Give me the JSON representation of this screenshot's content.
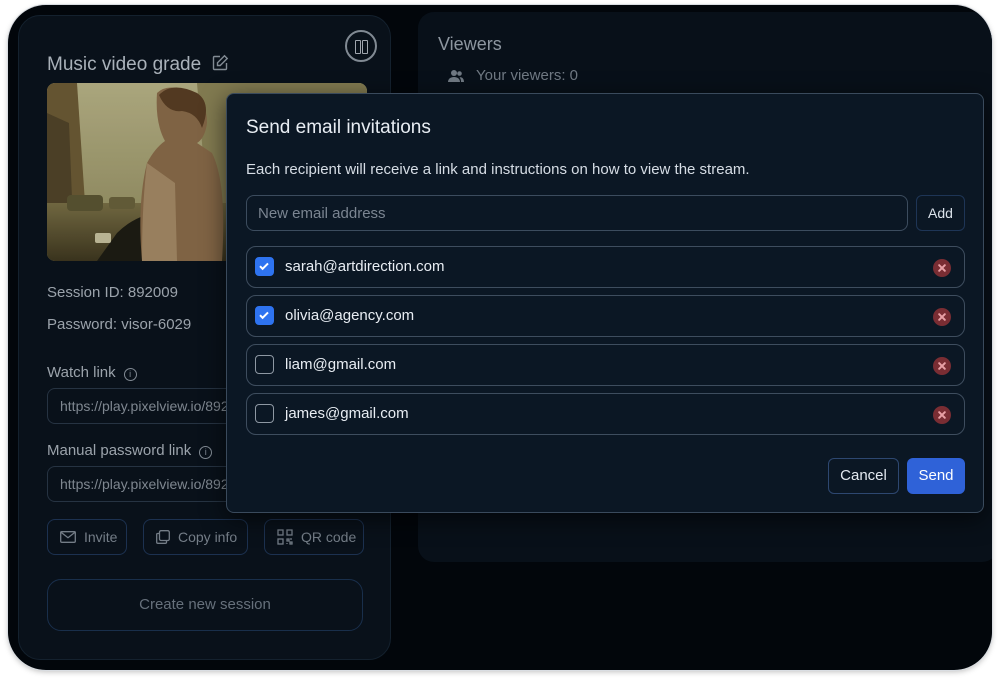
{
  "session": {
    "title": "Music video grade",
    "session_id": "Session ID: 892009",
    "password": "Password: visor-6029",
    "watch_link_label": "Watch link",
    "watch_link_value": "https://play.pixelview.io/892009",
    "manual_password_link_label": "Manual password link",
    "manual_password_link_value": "https://play.pixelview.io/892009",
    "buttons": {
      "invite": "Invite",
      "copy_info": "Copy info",
      "qr_code": "QR code",
      "create_new_session": "Create new session"
    }
  },
  "viewers": {
    "title": "Viewers",
    "count_text": "Your viewers: 0"
  },
  "modal": {
    "title": "Send email invitations",
    "description": "Each recipient will receive a link and instructions on how to view the stream.",
    "email_placeholder": "New email address",
    "add_label": "Add",
    "recipients": [
      {
        "email": "sarah@artdirection.com",
        "checked": true
      },
      {
        "email": "olivia@agency.com",
        "checked": true
      },
      {
        "email": "liam@gmail.com",
        "checked": false
      },
      {
        "email": "james@gmail.com",
        "checked": false
      }
    ],
    "cancel_label": "Cancel",
    "send_label": "Send"
  },
  "colors": {
    "accent": "#2f62d8",
    "checkbox_checked": "#2e73f0",
    "remove": "#7a2d33",
    "background": "#03070c"
  },
  "icons": [
    "edit-icon",
    "pause-icon",
    "info-icon",
    "mail-icon",
    "copy-icon",
    "qr-code-icon",
    "users-icon",
    "check-icon",
    "remove-icon"
  ]
}
